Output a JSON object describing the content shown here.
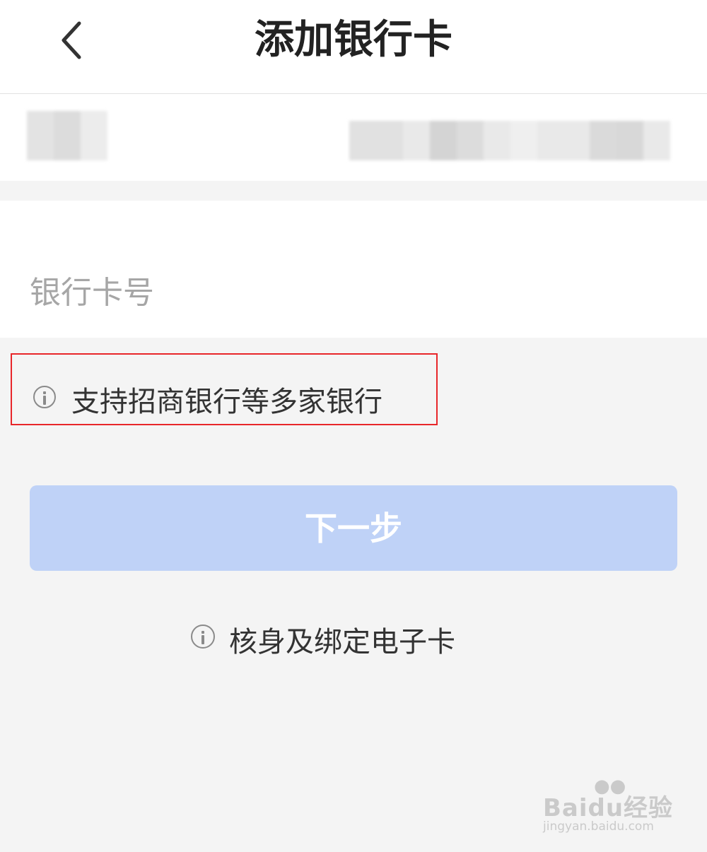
{
  "header": {
    "title": "添加银行卡",
    "back_icon": "chevron-left-icon"
  },
  "card_form": {
    "card_number_placeholder": "银行卡号"
  },
  "notice": {
    "icon": "info-icon",
    "text": "支持招商银行等多家银行"
  },
  "next_button": {
    "label": "下一步",
    "background_color": "#bfd2f7",
    "text_color": "#ffffff"
  },
  "ekyc_link": {
    "icon": "info-icon",
    "text": "核身及绑定电子卡"
  },
  "watermark": {
    "brand": "Baidu经验",
    "url": "jingyan.baidu.com"
  },
  "colors": {
    "highlight_border": "#e8262a",
    "page_background": "#f4f4f4"
  }
}
